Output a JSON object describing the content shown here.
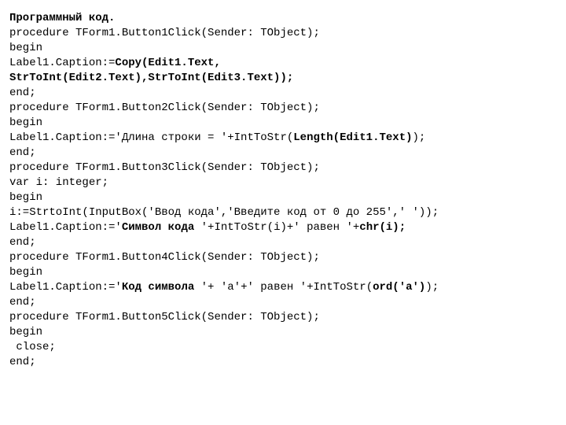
{
  "lines": [
    {
      "segments": [
        {
          "text": "Программный код.",
          "bold": true
        }
      ]
    },
    {
      "segments": [
        {
          "text": "procedure TForm1.Button1Click(Sender: TObject);",
          "bold": false
        }
      ]
    },
    {
      "segments": [
        {
          "text": "begin",
          "bold": false
        }
      ]
    },
    {
      "segments": [
        {
          "text": "Label1.Caption:=",
          "bold": false
        },
        {
          "text": "Copy(Edit1.Text,",
          "bold": true
        }
      ]
    },
    {
      "segments": [
        {
          "text": "StrToInt(Edit2.Text),StrToInt(Edit3.Text));",
          "bold": true
        }
      ]
    },
    {
      "segments": [
        {
          "text": "end;",
          "bold": false
        }
      ]
    },
    {
      "segments": [
        {
          "text": "procedure TForm1.Button2Click(Sender: TObject);",
          "bold": false
        }
      ]
    },
    {
      "segments": [
        {
          "text": "begin",
          "bold": false
        }
      ]
    },
    {
      "segments": [
        {
          "text": "Label1.Caption:='Длина строки = '+IntToStr(",
          "bold": false
        },
        {
          "text": "Length(Edit1.Text)",
          "bold": true
        },
        {
          "text": ");",
          "bold": false
        }
      ]
    },
    {
      "segments": [
        {
          "text": "end;",
          "bold": false
        }
      ]
    },
    {
      "segments": [
        {
          "text": "procedure TForm1.Button3Click(Sender: TObject);",
          "bold": false
        }
      ]
    },
    {
      "segments": [
        {
          "text": "var i: integer;",
          "bold": false
        }
      ]
    },
    {
      "segments": [
        {
          "text": "begin",
          "bold": false
        }
      ]
    },
    {
      "segments": [
        {
          "text": "i:=StrtoInt(InputBox('Ввод кода','Введите код от 0 до 255',' '));",
          "bold": false
        }
      ]
    },
    {
      "segments": [
        {
          "text": "Label1.Caption:='",
          "bold": false
        },
        {
          "text": "Символ кода ",
          "bold": true
        },
        {
          "text": "'+IntToStr(i)+' равен '+",
          "bold": false
        },
        {
          "text": "chr(i);",
          "bold": true
        }
      ]
    },
    {
      "segments": [
        {
          "text": "end;",
          "bold": false
        }
      ]
    },
    {
      "segments": [
        {
          "text": "procedure TForm1.Button4Click(Sender: TObject);",
          "bold": false
        }
      ]
    },
    {
      "segments": [
        {
          "text": "begin",
          "bold": false
        }
      ]
    },
    {
      "segments": [
        {
          "text": "Label1.Caption:='",
          "bold": false
        },
        {
          "text": "Код символа ",
          "bold": true
        },
        {
          "text": "'+ 'a'+' равен '+IntToStr(",
          "bold": false
        },
        {
          "text": "ord('a')",
          "bold": true
        },
        {
          "text": ");",
          "bold": false
        }
      ]
    },
    {
      "segments": [
        {
          "text": "end;",
          "bold": false
        }
      ]
    },
    {
      "segments": [
        {
          "text": "procedure TForm1.Button5Click(Sender: TObject);",
          "bold": false
        }
      ]
    },
    {
      "segments": [
        {
          "text": "begin",
          "bold": false
        }
      ]
    },
    {
      "segments": [
        {
          "text": " close;",
          "bold": false
        }
      ]
    },
    {
      "segments": [
        {
          "text": "end;",
          "bold": false
        }
      ]
    }
  ]
}
